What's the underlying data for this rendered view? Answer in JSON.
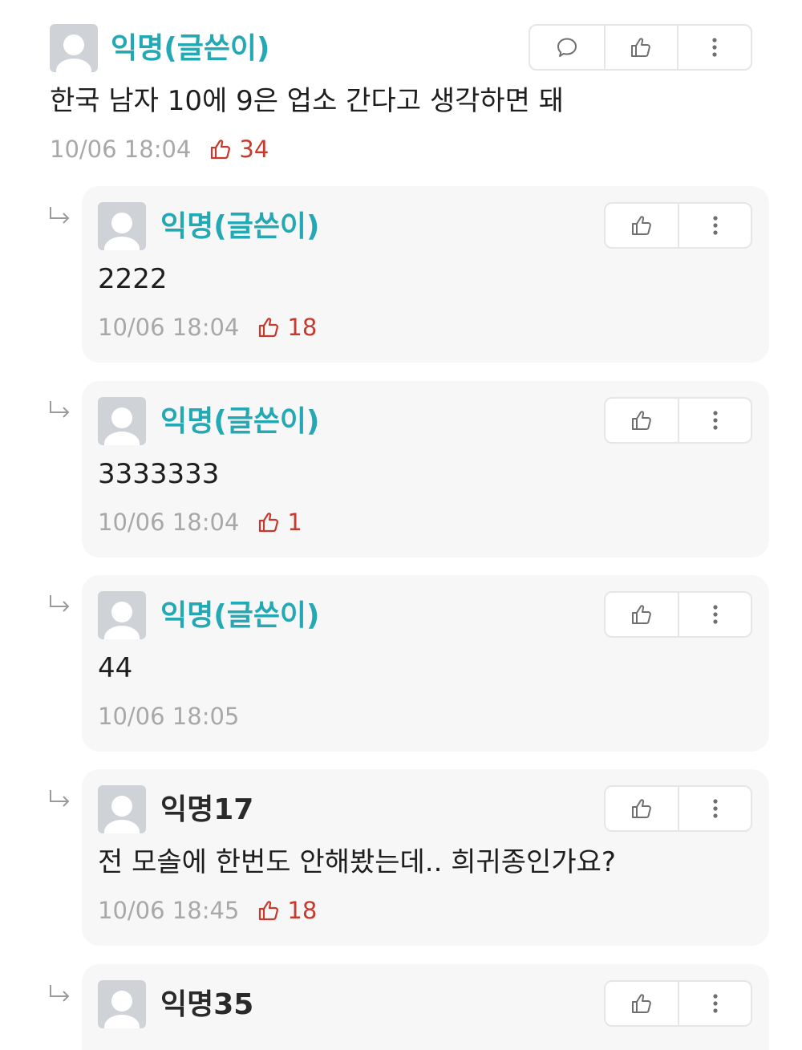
{
  "comments": [
    {
      "author": "익명(글쓴이)",
      "text": "한국 남자 10에 9은 업소 간다고 생각하면 돼",
      "time": "10/06 18:04",
      "likes": "34",
      "is_reply": false,
      "author_is_op": true
    },
    {
      "author": "익명(글쓴이)",
      "text": "2222",
      "time": "10/06 18:04",
      "likes": "18",
      "is_reply": true,
      "author_is_op": true
    },
    {
      "author": "익명(글쓴이)",
      "text": "3333333",
      "time": "10/06 18:04",
      "likes": "1",
      "is_reply": true,
      "author_is_op": true
    },
    {
      "author": "익명(글쓴이)",
      "text": "44",
      "time": "10/06 18:05",
      "likes": "",
      "is_reply": true,
      "author_is_op": true
    },
    {
      "author": "익명17",
      "text": "전 모솔에 한번도 안해봤는데.. 희귀종인가요?",
      "time": "10/06 18:45",
      "likes": "18",
      "is_reply": true,
      "author_is_op": false
    },
    {
      "author": "익명35",
      "text": "",
      "time": "",
      "likes": "",
      "is_reply": true,
      "author_is_op": false
    }
  ],
  "icons": {
    "reply": "speech-bubble-icon",
    "like": "thumbs-up-icon",
    "more": "more-vertical-icon",
    "reply_indicator": "reply-arrow-icon"
  },
  "colors": {
    "op_author": "#23a8b4",
    "author": "#2a2a2a",
    "likes": "#c8392d",
    "meta": "#a8a8a8",
    "reply_bg": "#f7f7f7"
  }
}
